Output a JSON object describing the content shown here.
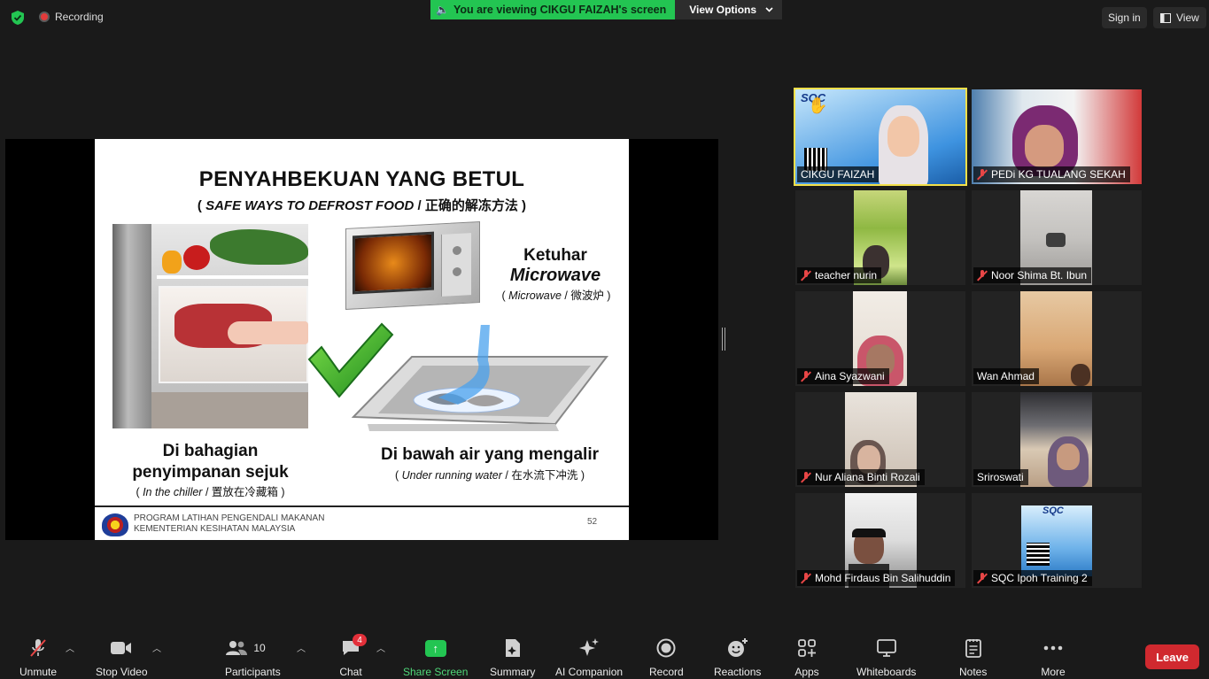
{
  "topbar": {
    "recording_label": "Recording",
    "viewing_text": "You are viewing CIKGU FAIZAH's screen",
    "view_options_label": "View Options",
    "sign_in_label": "Sign in",
    "view_label": "View"
  },
  "slide": {
    "title": "PENYAHBEKUAN YANG BETUL",
    "subtitle_open": "( ",
    "subtitle_en": "SAFE WAYS TO DEFROST FOOD",
    "subtitle_rest": " / 正确的解冻方法 )",
    "microwave_title": "Ketuhar",
    "microwave_title_en": "Microwave",
    "microwave_sub_open": "( ",
    "microwave_sub_en": "Microwave",
    "microwave_sub_rest": " / 微波炉 )",
    "chiller_caption_line1": "Di bahagian",
    "chiller_caption_line2": "penyimpanan sejuk",
    "chiller_sub_open": "( ",
    "chiller_sub_en": "In the chiller",
    "chiller_sub_rest": " / 置放在冷藏箱 )",
    "water_caption": "Di bawah air yang mengalir",
    "water_sub_open": "( ",
    "water_sub_en": "Under running water",
    "water_sub_rest": " / 在水流下冲洗 )",
    "footer_line1": "PROGRAM LATIHAN PENGENDALI MAKANAN",
    "footer_line2": "KEMENTERIAN KESIHATAN MALAYSIA",
    "page_number": "52"
  },
  "participants_tiles": [
    {
      "name": "CIKGU FAIZAH",
      "muted": false,
      "active": true
    },
    {
      "name": "PEDi KG TUALANG SEKAH",
      "muted": true
    },
    {
      "name": "teacher nurin",
      "muted": true
    },
    {
      "name": "Noor Shima Bt. Ibun",
      "muted": true
    },
    {
      "name": "Aina Syazwani",
      "muted": true
    },
    {
      "name": "Wan Ahmad",
      "muted": false
    },
    {
      "name": "Nur Aliana Binti Rozali",
      "muted": true
    },
    {
      "name": "Sriroswati",
      "muted": false
    },
    {
      "name": "Mohd Firdaus Bin Salihuddin",
      "muted": true
    },
    {
      "name": "SQC Ipoh Training 2",
      "muted": true
    }
  ],
  "tile_text": {
    "sqc_logo": "SQC"
  },
  "toolbar": {
    "unmute_label": "Unmute",
    "stop_video_label": "Stop Video",
    "participants_label": "Participants",
    "participants_count": "10",
    "chat_label": "Chat",
    "chat_badge": "4",
    "share_screen_label": "Share Screen",
    "summary_label": "Summary",
    "ai_companion_label": "AI Companion",
    "record_label": "Record",
    "reactions_label": "Reactions",
    "apps_label": "Apps",
    "whiteboards_label": "Whiteboards",
    "notes_label": "Notes",
    "more_label": "More",
    "leave_label": "Leave"
  },
  "icons": [
    "shield-icon",
    "recording-icon",
    "speaker-icon",
    "chevron-down-icon",
    "view-grid-icon",
    "mic-off-icon",
    "video-icon",
    "participants-icon",
    "chat-icon",
    "share-screen-icon",
    "summary-icon",
    "ai-sparkle-icon",
    "record-icon",
    "reactions-icon",
    "apps-icon",
    "whiteboard-icon",
    "notes-icon",
    "more-icon"
  ],
  "colors": {
    "viewing_banner": "#23c552",
    "active_speaker_border": "#f3e04a",
    "leave_button": "#d0292f",
    "chat_badge": "#e3303a",
    "muted_mic": "#e84646"
  }
}
